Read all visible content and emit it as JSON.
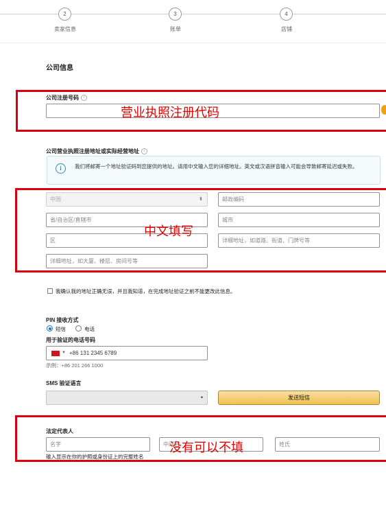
{
  "stepper": {
    "steps": [
      {
        "number": "2",
        "label": "卖家信息"
      },
      {
        "number": "3",
        "label": "账单"
      },
      {
        "number": "4",
        "label": "店铺"
      }
    ]
  },
  "section_title": "公司信息",
  "company_reg": {
    "label": "公司注册号码",
    "value": ""
  },
  "address": {
    "label": "公司营业执照注册地址或实际经营地址",
    "info_text": "我们将邮寄一个地址验证码到您提供的地址。请用中文输入您的详细地址。英文或汉语拼音输入可能会导致邮寄延迟或失败。",
    "country_value": "中国",
    "postal_placeholder": "邮政编码",
    "province_placeholder": "省/自治区/直辖市",
    "city_placeholder": "城市",
    "district_placeholder": "区",
    "street_placeholder": "详细地址，如道路、街道、门牌号等",
    "building_placeholder": "详细地址，如大厦、楼层、房间号等"
  },
  "confirm_text": "我确认我的地址正确无误，并且我知道，在完成地址验证之前不能更改此信息。",
  "pin": {
    "label": "PIN 接收方式",
    "option_sms": "短信",
    "option_phone": "电话",
    "phone_label": "用于验证的电话号码",
    "phone_value": "+86 131 2345 6789",
    "phone_example": "示例：+86 201 266 1000"
  },
  "sms": {
    "label": "SMS 验证语言",
    "language_value": "",
    "send_button": "发送短信"
  },
  "legal_rep": {
    "label": "法定代表人",
    "first_name_placeholder": "名字",
    "middle_name_placeholder": "中间名",
    "last_name_placeholder": "姓氏",
    "hint": "输入显示在你的护照或身份证上的完整姓名"
  },
  "annotations": {
    "business_license": "营业执照注册代码",
    "chinese_fill": "中文填写",
    "optional": "没有可以不填"
  },
  "colors": {
    "annotation_red": "#d8000f",
    "button_yellow": "#f0c14b",
    "info_teal": "#2f8fa6"
  }
}
